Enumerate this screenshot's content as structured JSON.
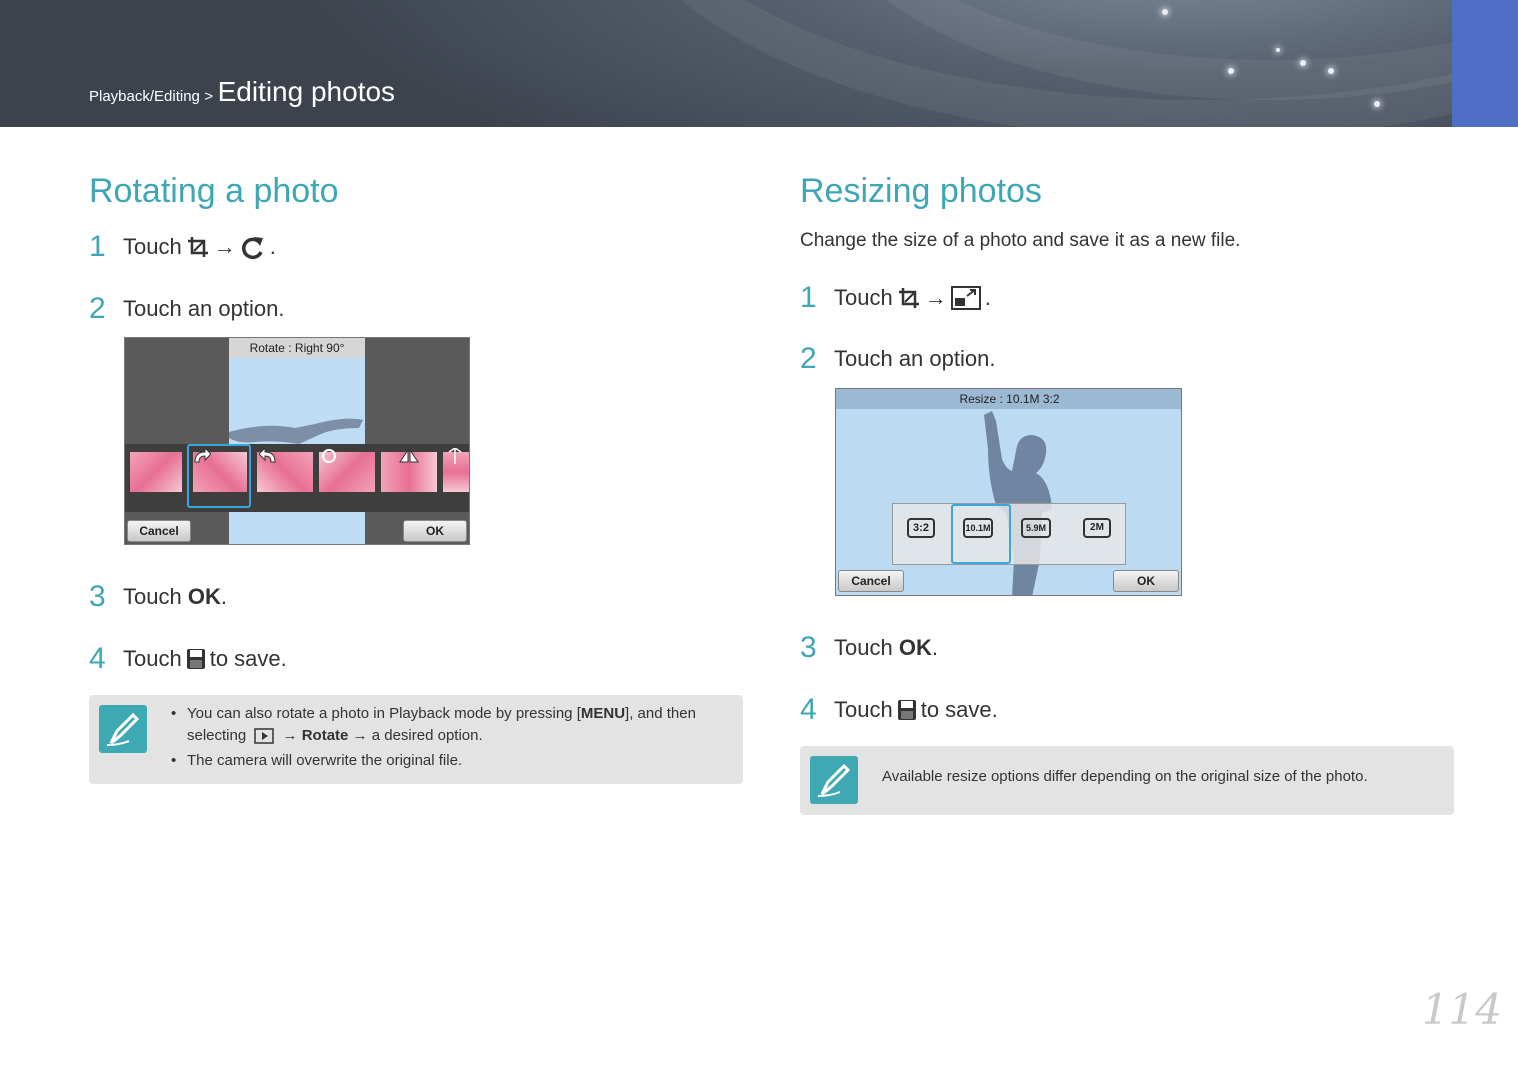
{
  "header": {
    "breadcrumb_section": "Playback/Editing",
    "breadcrumb_sep": ">",
    "breadcrumb_page": "Editing photos",
    "colors": {
      "tab": "#4e6fc4",
      "accent": "#3ea6b4"
    }
  },
  "rotate": {
    "title": "Rotating a photo",
    "steps": [
      {
        "num": "1",
        "pre": "Touch",
        "arrow": "→",
        "post": "."
      },
      {
        "num": "2",
        "text": "Touch an option."
      },
      {
        "num": "3",
        "pre": "Touch",
        "bold": "OK",
        "post": "."
      },
      {
        "num": "4",
        "pre": "Touch",
        "post": "to save."
      }
    ],
    "screen": {
      "caption": "Rotate : Right 90°",
      "cancel_label": "Cancel",
      "ok_label": "OK"
    },
    "note": {
      "bullet1_a": "You can also rotate a photo in Playback mode by pressing [",
      "menu_key": "MENU",
      "bullet1_b": "], and then",
      "bullet1_c": "selecting",
      "arrow": "→",
      "rotate_word": "Rotate",
      "bullet1_d": "→ a desired option.",
      "bullet2": "The camera will overwrite the original file."
    }
  },
  "resize": {
    "title": "Resizing photos",
    "lead": "Change the size of a photo and save it as a new file.",
    "steps": [
      {
        "num": "1",
        "pre": "Touch",
        "arrow": "→",
        "post": "."
      },
      {
        "num": "2",
        "text": "Touch an option."
      },
      {
        "num": "3",
        "pre": "Touch",
        "bold": "OK",
        "post": "."
      },
      {
        "num": "4",
        "pre": "Touch",
        "post": "to save."
      }
    ],
    "screen": {
      "caption": "Resize : 10.1M 3:2",
      "options": [
        "3:2",
        "10.1M",
        "5.9M",
        "2M"
      ],
      "cancel_label": "Cancel",
      "ok_label": "OK"
    },
    "note": "Available resize options differ depending on the original size of the photo."
  },
  "page_number": "114"
}
